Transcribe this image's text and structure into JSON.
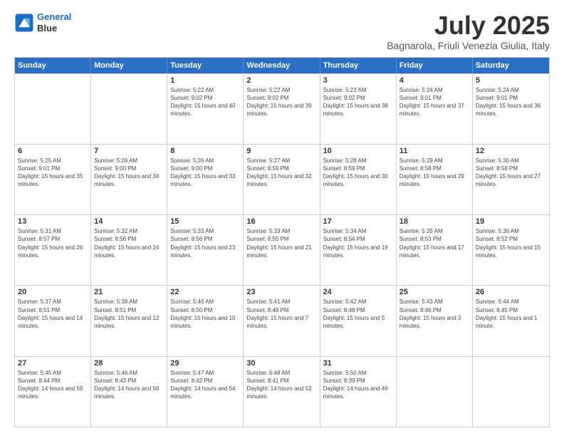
{
  "header": {
    "logo_line1": "General",
    "logo_line2": "Blue",
    "title": "July 2025",
    "subtitle": "Bagnarola, Friuli Venezia Giulia, Italy"
  },
  "calendar": {
    "days_of_week": [
      "Sunday",
      "Monday",
      "Tuesday",
      "Wednesday",
      "Thursday",
      "Friday",
      "Saturday"
    ],
    "weeks": [
      [
        {
          "day": "",
          "sunrise": "",
          "sunset": "",
          "daylight": ""
        },
        {
          "day": "",
          "sunrise": "",
          "sunset": "",
          "daylight": ""
        },
        {
          "day": "1",
          "sunrise": "Sunrise: 5:22 AM",
          "sunset": "Sunset: 9:02 PM",
          "daylight": "Daylight: 15 hours and 40 minutes."
        },
        {
          "day": "2",
          "sunrise": "Sunrise: 5:22 AM",
          "sunset": "Sunset: 9:02 PM",
          "daylight": "Daylight: 15 hours and 39 minutes."
        },
        {
          "day": "3",
          "sunrise": "Sunrise: 5:23 AM",
          "sunset": "Sunset: 9:02 PM",
          "daylight": "Daylight: 15 hours and 38 minutes."
        },
        {
          "day": "4",
          "sunrise": "Sunrise: 5:24 AM",
          "sunset": "Sunset: 9:01 PM",
          "daylight": "Daylight: 15 hours and 37 minutes."
        },
        {
          "day": "5",
          "sunrise": "Sunrise: 5:24 AM",
          "sunset": "Sunset: 9:01 PM",
          "daylight": "Daylight: 15 hours and 36 minutes."
        }
      ],
      [
        {
          "day": "6",
          "sunrise": "Sunrise: 5:25 AM",
          "sunset": "Sunset: 9:01 PM",
          "daylight": "Daylight: 15 hours and 35 minutes."
        },
        {
          "day": "7",
          "sunrise": "Sunrise: 5:26 AM",
          "sunset": "Sunset: 9:00 PM",
          "daylight": "Daylight: 15 hours and 34 minutes."
        },
        {
          "day": "8",
          "sunrise": "Sunrise: 5:26 AM",
          "sunset": "Sunset: 9:00 PM",
          "daylight": "Daylight: 15 hours and 33 minutes."
        },
        {
          "day": "9",
          "sunrise": "Sunrise: 5:27 AM",
          "sunset": "Sunset: 8:59 PM",
          "daylight": "Daylight: 15 hours and 32 minutes."
        },
        {
          "day": "10",
          "sunrise": "Sunrise: 5:28 AM",
          "sunset": "Sunset: 8:59 PM",
          "daylight": "Daylight: 15 hours and 30 minutes."
        },
        {
          "day": "11",
          "sunrise": "Sunrise: 5:29 AM",
          "sunset": "Sunset: 8:58 PM",
          "daylight": "Daylight: 15 hours and 29 minutes."
        },
        {
          "day": "12",
          "sunrise": "Sunrise: 5:30 AM",
          "sunset": "Sunset: 8:58 PM",
          "daylight": "Daylight: 15 hours and 27 minutes."
        }
      ],
      [
        {
          "day": "13",
          "sunrise": "Sunrise: 5:31 AM",
          "sunset": "Sunset: 8:57 PM",
          "daylight": "Daylight: 15 hours and 26 minutes."
        },
        {
          "day": "14",
          "sunrise": "Sunrise: 5:32 AM",
          "sunset": "Sunset: 8:56 PM",
          "daylight": "Daylight: 15 hours and 24 minutes."
        },
        {
          "day": "15",
          "sunrise": "Sunrise: 5:33 AM",
          "sunset": "Sunset: 8:56 PM",
          "daylight": "Daylight: 15 hours and 23 minutes."
        },
        {
          "day": "16",
          "sunrise": "Sunrise: 5:33 AM",
          "sunset": "Sunset: 8:55 PM",
          "daylight": "Daylight: 15 hours and 21 minutes."
        },
        {
          "day": "17",
          "sunrise": "Sunrise: 5:34 AM",
          "sunset": "Sunset: 8:54 PM",
          "daylight": "Daylight: 15 hours and 19 minutes."
        },
        {
          "day": "18",
          "sunrise": "Sunrise: 5:35 AM",
          "sunset": "Sunset: 8:53 PM",
          "daylight": "Daylight: 15 hours and 17 minutes."
        },
        {
          "day": "19",
          "sunrise": "Sunrise: 5:36 AM",
          "sunset": "Sunset: 8:52 PM",
          "daylight": "Daylight: 15 hours and 15 minutes."
        }
      ],
      [
        {
          "day": "20",
          "sunrise": "Sunrise: 5:37 AM",
          "sunset": "Sunset: 8:51 PM",
          "daylight": "Daylight: 15 hours and 14 minutes."
        },
        {
          "day": "21",
          "sunrise": "Sunrise: 5:38 AM",
          "sunset": "Sunset: 8:51 PM",
          "daylight": "Daylight: 15 hours and 12 minutes."
        },
        {
          "day": "22",
          "sunrise": "Sunrise: 5:40 AM",
          "sunset": "Sunset: 8:50 PM",
          "daylight": "Daylight: 15 hours and 10 minutes."
        },
        {
          "day": "23",
          "sunrise": "Sunrise: 5:41 AM",
          "sunset": "Sunset: 8:49 PM",
          "daylight": "Daylight: 15 hours and 7 minutes."
        },
        {
          "day": "24",
          "sunrise": "Sunrise: 5:42 AM",
          "sunset": "Sunset: 8:48 PM",
          "daylight": "Daylight: 15 hours and 5 minutes."
        },
        {
          "day": "25",
          "sunrise": "Sunrise: 5:43 AM",
          "sunset": "Sunset: 8:46 PM",
          "daylight": "Daylight: 15 hours and 3 minutes."
        },
        {
          "day": "26",
          "sunrise": "Sunrise: 5:44 AM",
          "sunset": "Sunset: 8:45 PM",
          "daylight": "Daylight: 15 hours and 1 minute."
        }
      ],
      [
        {
          "day": "27",
          "sunrise": "Sunrise: 5:45 AM",
          "sunset": "Sunset: 8:44 PM",
          "daylight": "Daylight: 14 hours and 59 minutes."
        },
        {
          "day": "28",
          "sunrise": "Sunrise: 5:46 AM",
          "sunset": "Sunset: 8:43 PM",
          "daylight": "Daylight: 14 hours and 56 minutes."
        },
        {
          "day": "29",
          "sunrise": "Sunrise: 5:47 AM",
          "sunset": "Sunset: 8:42 PM",
          "daylight": "Daylight: 14 hours and 54 minutes."
        },
        {
          "day": "30",
          "sunrise": "Sunrise: 5:48 AM",
          "sunset": "Sunset: 8:41 PM",
          "daylight": "Daylight: 14 hours and 52 minutes."
        },
        {
          "day": "31",
          "sunrise": "Sunrise: 5:50 AM",
          "sunset": "Sunset: 8:39 PM",
          "daylight": "Daylight: 14 hours and 49 minutes."
        },
        {
          "day": "",
          "sunrise": "",
          "sunset": "",
          "daylight": ""
        },
        {
          "day": "",
          "sunrise": "",
          "sunset": "",
          "daylight": ""
        }
      ]
    ]
  }
}
